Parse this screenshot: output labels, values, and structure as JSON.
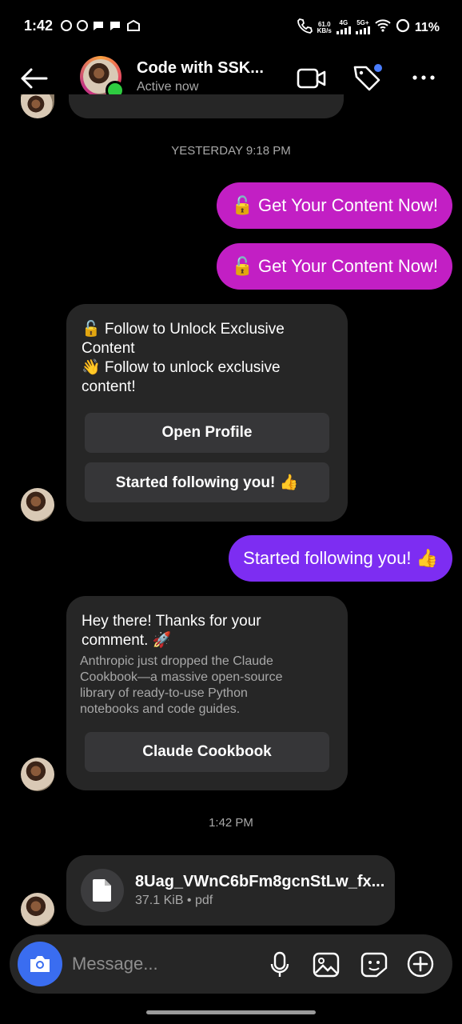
{
  "status": {
    "time": "1:42",
    "net_speed_top": "61.0",
    "net_speed_bottom": "KB/s",
    "net_4g": "4G",
    "net_5g": "5G+",
    "battery": "11%"
  },
  "header": {
    "name": "Code with SSK...",
    "status": "Active now"
  },
  "messages": {
    "ts1": "YESTERDAY 9:18 PM",
    "out1": "🔓 Get Your Content Now!",
    "out2": "🔓 Get Your Content Now!",
    "card1_line1": "🔓 Follow to Unlock Exclusive",
    "card1_line2": "Content",
    "card1_line3": "👋 Follow to unlock exclusive",
    "card1_line4": "content!",
    "card1_btn1": "Open Profile",
    "card1_btn2": "Started following you! 👍",
    "out3": "Started following you! 👍",
    "card2_title1": "Hey there! Thanks for your",
    "card2_title2": "comment. 🚀",
    "card2_body1": "Anthropic just dropped the Claude",
    "card2_body2": "Cookbook—a massive open-source",
    "card2_body3": "library of ready-to-use Python",
    "card2_body4": "notebooks and code guides.",
    "card2_btn": "Claude Cookbook",
    "ts2": "1:42 PM",
    "file_name": "8Uag_VWnC6bFm8gcnStLw_fx...",
    "file_meta": "37.1 KiB • pdf"
  },
  "composer": {
    "placeholder": "Message..."
  },
  "colors": {
    "magenta_bubble": "#c21fc4",
    "purple_bubble": "#7d2df2",
    "card_bg": "#262626",
    "camera": "#3a6df0"
  }
}
